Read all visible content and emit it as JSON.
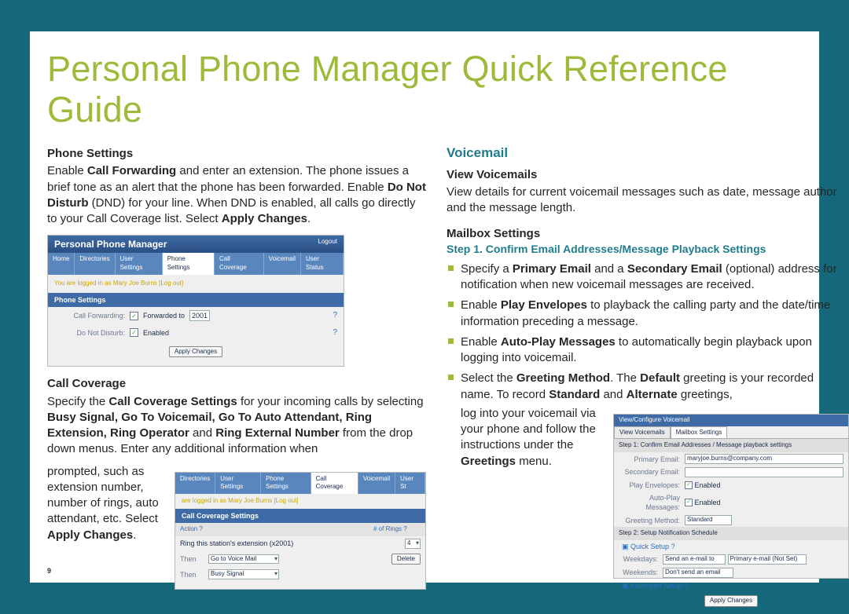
{
  "title": "Personal Phone Manager Quick Reference Guide",
  "page_number": "9",
  "left": {
    "phone_settings_h": "Phone Settings",
    "phone_settings_p_pre": "Enable ",
    "phone_settings_cf": "Call Forwarding",
    "phone_settings_p_mid": " and enter an extension. The phone issues a brief tone as an alert that the phone has been forwarded. Enable ",
    "phone_settings_dnd": "Do Not Disturb",
    "phone_settings_p_after_dnd": " (DND) for your line. When DND is enabled, all calls go directly to your Call Coverage list. Select ",
    "apply_changes": "Apply Changes",
    "period": ".",
    "call_cov_h": "Call Coverage",
    "cc_p1_pre": "Specify the ",
    "cc_settings": "Call Coverage Settings",
    "cc_p1_mid": " for your incoming calls by selecting ",
    "cc_opts": "Busy Signal, Go To Voicemail, Go To Auto Attendant, Ring Extension, Ring Operator",
    "cc_and": " and ",
    "cc_ring_ext": "Ring External Number",
    "cc_from": " from the drop down menus. Enter any additional information when",
    "cc_tail": "prompted, such as extension number, number of rings, auto attendant, etc. Select ",
    "cc_applyb": "Apply Changes"
  },
  "right": {
    "voicemail_h": "Voicemail",
    "view_vm_h": "View Voicemails",
    "view_vm_p": "View details for current voicemail messages such as date, message author and the message length.",
    "mbox_h": "Mailbox Settings",
    "step1": "Step 1. Confirm Email Addresses/Message Playback Settings",
    "b1_pre": "Specify a ",
    "b1_pe": "Primary Email",
    "b1_and": " and a ",
    "b1_se": "Secondary Email",
    "b1_tail": " (optional) address for notification when new voicemail messages are received.",
    "b2_pre": "Enable ",
    "b2_pe": "Play Envelopes",
    "b2_tail": " to playback the calling party and the date/time information preceding a message.",
    "b3_pre": "Enable ",
    "b3_apm": "Auto-Play Messages",
    "b3_tail": " to automatically begin playback upon logging into voicemail.",
    "b4_pre": "Select the ",
    "b4_gm": "Greeting Method",
    "b4_mid": ". The ",
    "b4_def": "Default",
    "b4_mid2": " greeting is your recorded name. To record ",
    "b4_std": "Standard",
    "b4_and": " and ",
    "b4_alt": "Alternate",
    "b4_tail_a": " greetings,",
    "b4_tail_left": "log into your voicemail via your phone and follow the instructions under the ",
    "b4_greet": "Greetings",
    "b4_menu": " menu."
  },
  "fig1": {
    "title": "Personal Phone Manager",
    "logout": "Logout",
    "tabs": [
      "Home",
      "Directories",
      "User Settings",
      "Phone Settings",
      "Call Coverage",
      "Voicemail",
      "User Status"
    ],
    "active_tab": "Phone Settings",
    "logged": "You are logged in as Mary Joe Burns [Log out]",
    "panel": "Phone Settings",
    "row1_label": "Call Forwarding:",
    "row1_chk": "✓",
    "row1_fwd": "Forwarded to",
    "row1_ext": "2001",
    "row2_label": "Do Not Disturb:",
    "row2_chk": "✓",
    "row2_en": "Enabled",
    "apply": "Apply Changes"
  },
  "fig2": {
    "tabs": [
      "Directories",
      "User Settings",
      "Phone Settings",
      "Call Coverage",
      "Voicemail",
      "User St"
    ],
    "active_tab": "Call Coverage",
    "logged": "are logged in as Mary Joe Burns [Log out]",
    "panel": "Call Coverage Settings",
    "hdr_action": "Action",
    "hdr_rings": "# of Rings",
    "ring_station": "Ring this station's extension (x2001)",
    "ring_val": "4",
    "then": "Then",
    "opt1": "Go to Voice Mail",
    "delete": "Delete",
    "opt2": "Busy Signal"
  },
  "fig3": {
    "topbar": "View/Configure Voicemail",
    "tab1": "View Voicemails",
    "tab2": "Mailbox Settings",
    "stepA": "Step 1: Confirm Email Addresses / Message playback settings",
    "r1l": "Primary Email:",
    "r1v": "maryjoe.burns@company.com",
    "r2l": "Secondary Email:",
    "r3l": "Play Envelopes:",
    "r3v": "Enabled",
    "r4l": "Auto-Play Messages:",
    "r4v": "Enabled",
    "r5l": "Greeting Method:",
    "r5v": "Standard",
    "stepB": "Step 2: Setup Notification Schedule",
    "quick": "Quick Setup",
    "wk_l": "Weekdays:",
    "wk_v1": "Send an e-mail to",
    "wk_v2": "Primary e-mail (Not Set)",
    "we_l": "Weekends:",
    "we_v": "Don't send an email",
    "adv": "Advanced Setup",
    "apply": "Apply Changes"
  }
}
